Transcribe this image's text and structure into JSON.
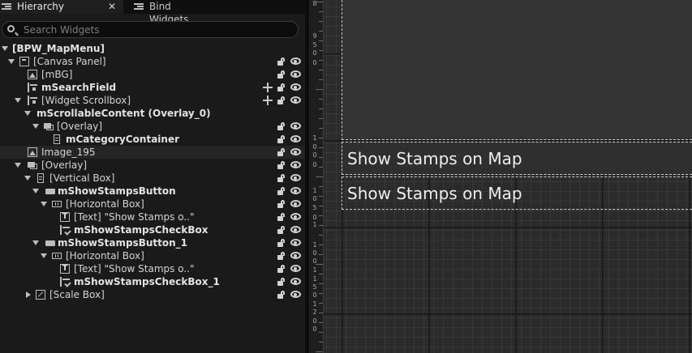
{
  "tabs": {
    "hierarchy": "Hierarchy",
    "bind_widgets": "Bind Widgets",
    "close_glyph": "✕"
  },
  "search": {
    "placeholder": "Search Widgets"
  },
  "tree": [
    {
      "name": "tree-row-root",
      "label": "[BPW_MapMenu]",
      "icon": null,
      "arrow": "down",
      "bold": true,
      "lock": false,
      "eye": false,
      "move": false
    },
    {
      "name": "tree-row-canvas-panel",
      "label": "[Canvas Panel]",
      "icon": "canvas-icon",
      "arrow": "down",
      "bold": false,
      "lock": true,
      "eye": true,
      "move": false
    },
    {
      "name": "tree-row-mbg",
      "label": "[mBG]",
      "icon": "image-icon",
      "arrow": null,
      "bold": false,
      "lock": true,
      "eye": true,
      "move": false
    },
    {
      "name": "tree-row-msearchfield",
      "label": "mSearchField",
      "icon": "field-icon",
      "arrow": null,
      "bold": true,
      "lock": true,
      "eye": true,
      "move": true
    },
    {
      "name": "tree-row-widget-scrollbox",
      "label": "[Widget Scrollbox]",
      "icon": "field-icon",
      "arrow": "down",
      "bold": false,
      "lock": true,
      "eye": true,
      "move": true
    },
    {
      "name": "tree-row-mscrollablecontent",
      "label": "mScrollableContent (Overlay_0)",
      "icon": null,
      "arrow": "down",
      "bold": true,
      "lock": false,
      "eye": false,
      "move": false
    },
    {
      "name": "tree-row-overlay-inner",
      "label": "[Overlay]",
      "icon": "overlay-icon",
      "arrow": "down",
      "bold": false,
      "lock": true,
      "eye": true,
      "move": false
    },
    {
      "name": "tree-row-mcategorycontainer",
      "label": "mCategoryContainer",
      "icon": "vbox-icon",
      "arrow": null,
      "bold": true,
      "lock": true,
      "eye": true,
      "move": false
    },
    {
      "name": "tree-row-image-195",
      "label": "Image_195",
      "icon": "image-icon",
      "arrow": null,
      "bold": false,
      "lock": true,
      "eye": true,
      "move": false,
      "hl": true
    },
    {
      "name": "tree-row-overlay",
      "label": "[Overlay]",
      "icon": "overlay-icon",
      "arrow": "down",
      "bold": false,
      "lock": true,
      "eye": true,
      "move": false
    },
    {
      "name": "tree-row-vertical-box",
      "label": "[Vertical Box]",
      "icon": "vbox-icon",
      "arrow": "down",
      "bold": false,
      "lock": true,
      "eye": true,
      "move": false
    },
    {
      "name": "tree-row-mshowstampsbutton",
      "label": "mShowStampsButton",
      "icon": "button-icon",
      "arrow": "down",
      "bold": true,
      "lock": true,
      "eye": true,
      "move": false
    },
    {
      "name": "tree-row-horizontal-box",
      "label": "[Horizontal Box]",
      "icon": "hbox-icon",
      "arrow": "down",
      "bold": false,
      "lock": true,
      "eye": true,
      "move": false
    },
    {
      "name": "tree-row-text",
      "label": "[Text] \"Show Stamps o..\"",
      "icon": "text-icon",
      "arrow": null,
      "bold": false,
      "lock": true,
      "eye": true,
      "move": false
    },
    {
      "name": "tree-row-mshowstampscheckbox",
      "label": "mShowStampsCheckBox",
      "icon": "check-icon",
      "arrow": null,
      "bold": true,
      "lock": true,
      "eye": true,
      "move": false
    },
    {
      "name": "tree-row-mshowstampsbutton-1",
      "label": "mShowStampsButton_1",
      "icon": "button-icon",
      "arrow": "down",
      "bold": true,
      "lock": true,
      "eye": true,
      "move": false
    },
    {
      "name": "tree-row-horizontal-box-1",
      "label": "[Horizontal Box]",
      "icon": "hbox-icon",
      "arrow": "down",
      "bold": false,
      "lock": true,
      "eye": true,
      "move": false
    },
    {
      "name": "tree-row-text-1",
      "label": "[Text] \"Show Stamps o..\"",
      "icon": "text-icon",
      "arrow": null,
      "bold": false,
      "lock": true,
      "eye": true,
      "move": false
    },
    {
      "name": "tree-row-mshowstampscheckbox-1",
      "label": "mShowStampsCheckBox_1",
      "icon": "check-icon",
      "arrow": null,
      "bold": true,
      "lock": true,
      "eye": true,
      "move": false
    },
    {
      "name": "tree-row-scale-box",
      "label": "[Scale Box]",
      "icon": "scale-icon",
      "arrow": "right",
      "bold": false,
      "lock": true,
      "eye": true,
      "move": false
    }
  ],
  "ruler_labels": [
    "8",
    "9",
    "5",
    "0",
    "0",
    "1",
    "0",
    "0",
    "0",
    "1",
    "0",
    "5",
    "0",
    "1",
    "1",
    "0",
    "0",
    "1",
    "1",
    "5",
    "0",
    "1",
    "2",
    "0",
    "0"
  ],
  "canvas": {
    "stamp_1": "Show Stamps on Map",
    "stamp_2": "Show Stamps on Map"
  }
}
